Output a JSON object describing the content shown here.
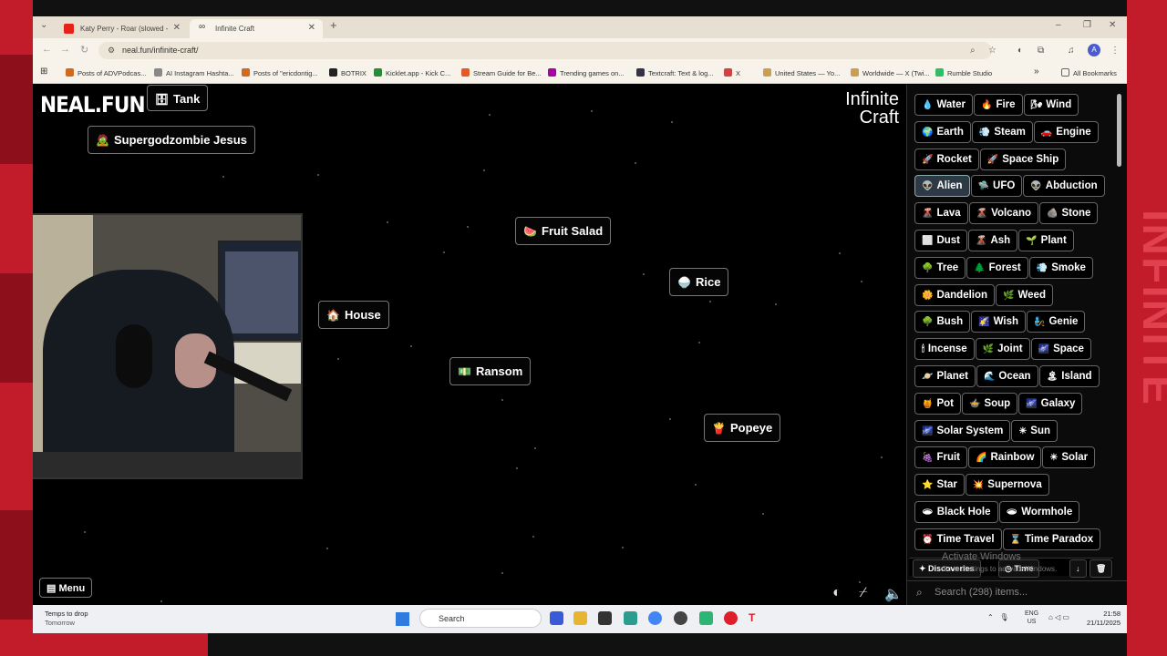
{
  "browser": {
    "tabs": [
      {
        "label": "Katy Perry - Roar (slowed -",
        "active": false
      },
      {
        "label": "Infinite Craft",
        "active": true
      }
    ],
    "new_tab": "+",
    "window_controls": {
      "minimize": "–",
      "restore": "❐",
      "close": "✕"
    },
    "url": "neal.fun/infinite-craft/",
    "avatar": "A",
    "bookmarks": [
      "Posts of ADVPodcas...",
      "AI Instagram Hashta...",
      "Posts of \"ericdontig...",
      "BOTRIX",
      "Kicklet.app - Kick C...",
      "Stream Guide for Be...",
      "Trending games on...",
      "Textcraft: Text & log...",
      "X",
      "United States — Yo...",
      "Worldwide — X (Twi...",
      "Rumble Studio"
    ],
    "more_bookmarks": "»",
    "all_bookmarks": "All Bookmarks"
  },
  "game": {
    "site_logo": "NEAL.FUN",
    "title_line1": "Infinite",
    "title_line2": "Craft",
    "canvas_items": [
      {
        "emoji": "🗄",
        "label": "Tank"
      },
      {
        "emoji": "🧟",
        "label": "Supergodzombie Jesus"
      },
      {
        "emoji": "🍉",
        "label": "Fruit Salad"
      },
      {
        "emoji": "🍚",
        "label": "Rice"
      },
      {
        "emoji": "🏠",
        "label": "House"
      },
      {
        "emoji": "💵",
        "label": "Ransom"
      },
      {
        "emoji": "🍟",
        "label": "Popeye"
      }
    ],
    "menu_label": "Menu",
    "sidebar_items": [
      {
        "emoji": "💧",
        "label": "Water"
      },
      {
        "emoji": "🔥",
        "label": "Fire"
      },
      {
        "emoji": "🌬",
        "label": "Wind"
      },
      {
        "emoji": "🌍",
        "label": "Earth"
      },
      {
        "emoji": "💨",
        "label": "Steam"
      },
      {
        "emoji": "🚗",
        "label": "Engine"
      },
      {
        "emoji": "🚀",
        "label": "Rocket"
      },
      {
        "emoji": "🚀",
        "label": "Space Ship"
      },
      {
        "emoji": "👽",
        "label": "Alien"
      },
      {
        "emoji": "🛸",
        "label": "UFO"
      },
      {
        "emoji": "👽",
        "label": "Abduction"
      },
      {
        "emoji": "🌋",
        "label": "Lava"
      },
      {
        "emoji": "🌋",
        "label": "Volcano"
      },
      {
        "emoji": "🪨",
        "label": "Stone"
      },
      {
        "emoji": "⬜",
        "label": "Dust"
      },
      {
        "emoji": "🌋",
        "label": "Ash"
      },
      {
        "emoji": "🌱",
        "label": "Plant"
      },
      {
        "emoji": "🌳",
        "label": "Tree"
      },
      {
        "emoji": "🌲",
        "label": "Forest"
      },
      {
        "emoji": "💨",
        "label": "Smoke"
      },
      {
        "emoji": "🌼",
        "label": "Dandelion"
      },
      {
        "emoji": "🌿",
        "label": "Weed"
      },
      {
        "emoji": "🌳",
        "label": "Bush"
      },
      {
        "emoji": "🌠",
        "label": "Wish"
      },
      {
        "emoji": "🧞",
        "label": "Genie"
      },
      {
        "emoji": "🕯",
        "label": "Incense"
      },
      {
        "emoji": "🌿",
        "label": "Joint"
      },
      {
        "emoji": "🌌",
        "label": "Space"
      },
      {
        "emoji": "🪐",
        "label": "Planet"
      },
      {
        "emoji": "🌊",
        "label": "Ocean"
      },
      {
        "emoji": "🏝",
        "label": "Island"
      },
      {
        "emoji": "🍯",
        "label": "Pot"
      },
      {
        "emoji": "🍲",
        "label": "Soup"
      },
      {
        "emoji": "🌌",
        "label": "Galaxy"
      },
      {
        "emoji": "🌌",
        "label": "Solar System"
      },
      {
        "emoji": "☀",
        "label": "Sun"
      },
      {
        "emoji": "🍇",
        "label": "Fruit"
      },
      {
        "emoji": "🌈",
        "label": "Rainbow"
      },
      {
        "emoji": "☀",
        "label": "Solar"
      },
      {
        "emoji": "⭐",
        "label": "Star"
      },
      {
        "emoji": "💥",
        "label": "Supernova"
      },
      {
        "emoji": "🕳",
        "label": "Black Hole"
      },
      {
        "emoji": "🕳",
        "label": "Wormhole"
      },
      {
        "emoji": "⏰",
        "label": "Time Travel"
      },
      {
        "emoji": "⌛",
        "label": "Time Paradox"
      }
    ],
    "selected_item": "Alien",
    "sort_discoveries": "Discoveries",
    "sort_time": "Time",
    "search_placeholder": "Search (298) items...",
    "watermark_line1": "Activate Windows",
    "watermark_line2": "Go to Settings to activate Windows."
  },
  "taskbar": {
    "weather_line1": "Temps to drop",
    "weather_line2": "Tomorrow",
    "search_label": "Search",
    "lang_line1": "ENG",
    "lang_line2": "US",
    "time": "21:58",
    "date": "21/11/2025"
  },
  "overlay": {
    "side_text": "INFINITE"
  }
}
